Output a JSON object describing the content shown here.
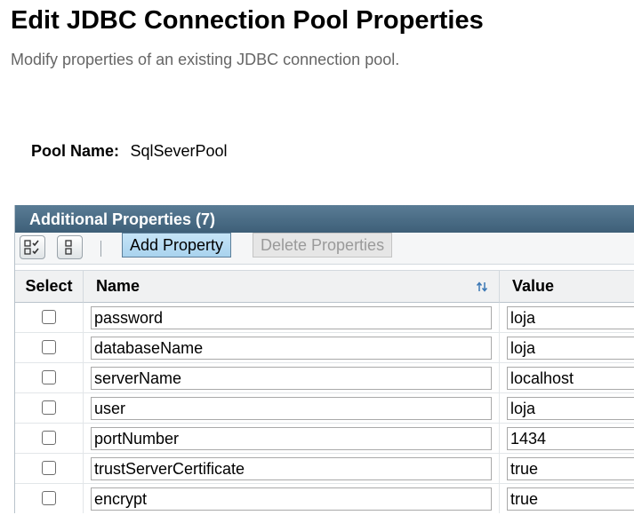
{
  "page": {
    "title": "Edit JDBC Connection Pool Properties",
    "subtitle": "Modify properties of an existing JDBC connection pool."
  },
  "pool": {
    "label": "Pool Name:",
    "value": "SqlSeverPool"
  },
  "table": {
    "title": "Additional Properties (7)",
    "toolbar": {
      "select_all_icon": "select-all-icon",
      "deselect_all_icon": "deselect-all-icon",
      "add_label": "Add Property",
      "delete_label": "Delete Properties"
    },
    "columns": {
      "select": "Select",
      "name": "Name",
      "value": "Value"
    },
    "rows": [
      {
        "name": "password",
        "value": "loja",
        "selected": false
      },
      {
        "name": "databaseName",
        "value": "loja",
        "selected": false
      },
      {
        "name": "serverName",
        "value": "localhost",
        "selected": false
      },
      {
        "name": "user",
        "value": "loja",
        "selected": false
      },
      {
        "name": "portNumber",
        "value": "1434",
        "selected": false
      },
      {
        "name": "trustServerCertificate",
        "value": "true",
        "selected": false
      },
      {
        "name": "encrypt",
        "value": "true",
        "selected": false
      }
    ]
  },
  "colors": {
    "header_bar": "#4a6c85",
    "add_button": "#a9d3ee",
    "subtitle": "#666666"
  }
}
